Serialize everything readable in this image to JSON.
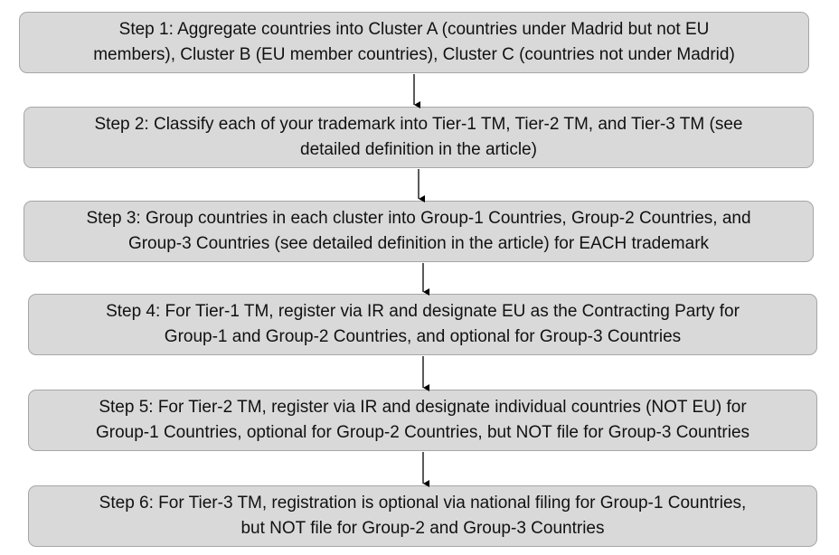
{
  "steps": [
    {
      "line1": "Step 1: Aggregate countries into Cluster A (countries under Madrid but not EU",
      "line2": "members), Cluster B (EU member countries), Cluster C (countries not under Madrid)"
    },
    {
      "line1": "Step 2: Classify each of your trademark into Tier-1 TM, Tier-2 TM, and Tier-3 TM (see",
      "line2": "detailed definition in the article)"
    },
    {
      "line1": "Step 3: Group countries in each cluster into Group-1 Countries, Group-2 Countries, and",
      "line2": "Group-3 Countries (see detailed definition in the article) for EACH trademark"
    },
    {
      "line1": "Step 4: For Tier-1 TM, register via IR and designate EU as the Contracting Party for",
      "line2": "Group-1 and Group-2 Countries, and optional for Group-3 Countries"
    },
    {
      "line1": "Step 5: For Tier-2 TM, register via IR and designate individual countries (NOT EU) for",
      "line2": "Group-1 Countries, optional for Group-2 Countries, but NOT file for Group-3 Countries"
    },
    {
      "line1": "Step 6: For Tier-3 TM, registration is optional via national filing for Group-1 Countries,",
      "line2": "but NOT file for Group-2 and Group-3 Countries"
    }
  ],
  "colors": {
    "box_fill": "#d9d9d9",
    "box_border": "#a6a6a6",
    "text": "#111111",
    "arrow": "#000000"
  }
}
